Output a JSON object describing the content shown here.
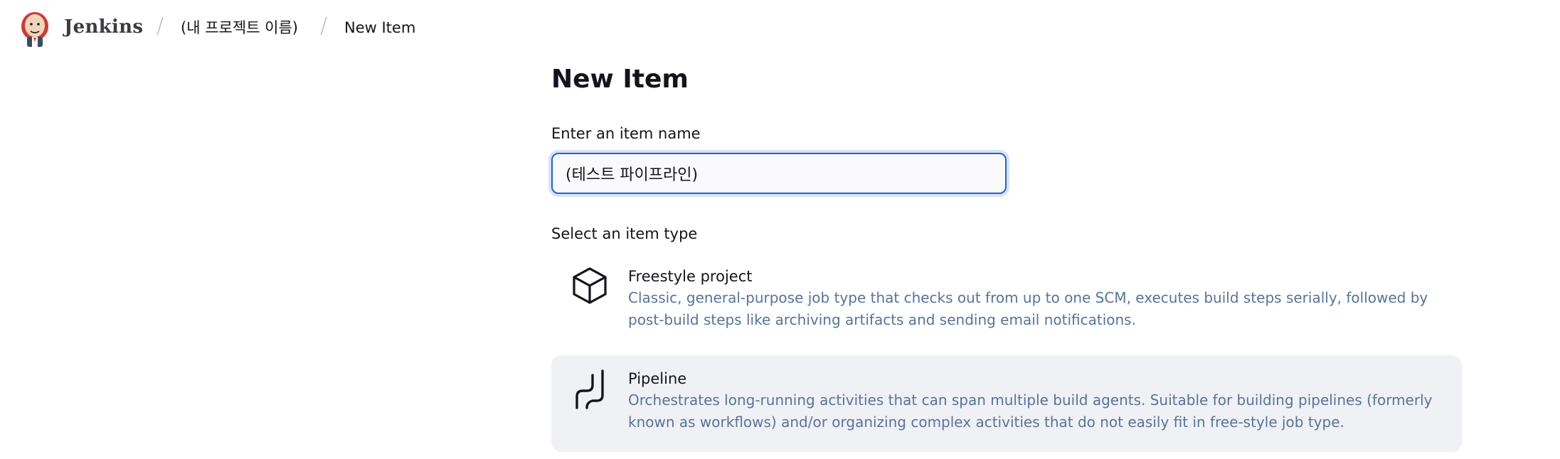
{
  "header": {
    "brand": "Jenkins",
    "breadcrumbs": [
      {
        "label": "(내 프로젝트 이름)"
      },
      {
        "label": "New Item"
      }
    ],
    "separator": "/"
  },
  "main": {
    "title": "New Item",
    "name_field": {
      "label": "Enter an item name",
      "value": "(테스트 파이프라인)"
    },
    "type_section_label": "Select an item type",
    "item_types": [
      {
        "name": "Freestyle project",
        "description": "Classic, general-purpose job type that checks out from up to one SCM, executes build steps serially, followed by post-build steps like archiving artifacts and sending email notifications.",
        "icon": "cube-icon",
        "selected": false
      },
      {
        "name": "Pipeline",
        "description": "Orchestrates long-running activities that can span multiple build agents. Suitable for building pipelines (formerly known as workflows) and/or organizing complex activities that do not easily fit in free-style job type.",
        "icon": "pipeline-icon",
        "selected": true
      }
    ]
  },
  "colors": {
    "accent": "#1d63de",
    "description_text": "#5474a0",
    "selected_bg": "#f0f1f4"
  }
}
